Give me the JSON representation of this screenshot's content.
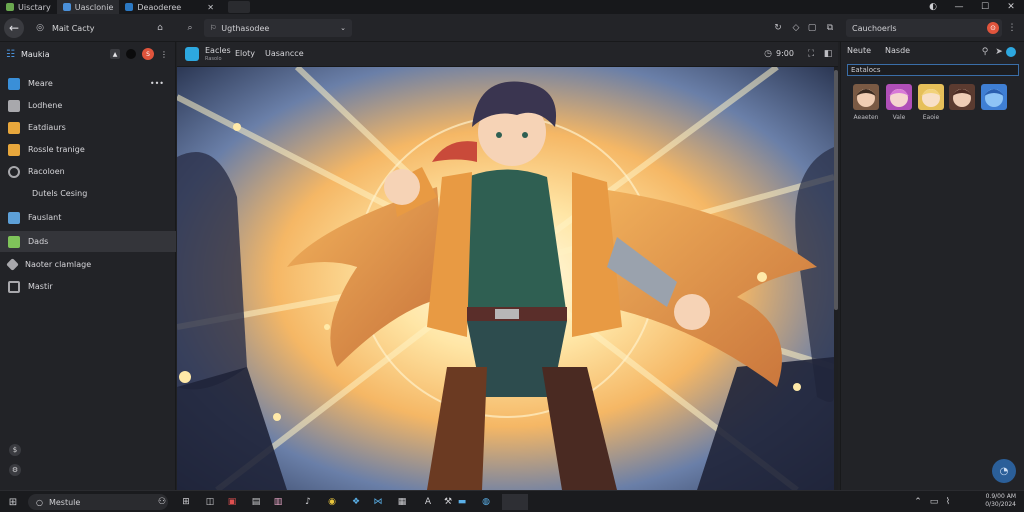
{
  "tabs": [
    {
      "label": "Uisctary",
      "active": false,
      "color": "#6aa84f"
    },
    {
      "label": "Uasclonie",
      "active": true,
      "color": "#4a90d9"
    },
    {
      "label": "Deaoderee",
      "active": false,
      "color": "#2b78c2"
    }
  ],
  "tab_close": "✕",
  "window_controls": {
    "minimize": "—",
    "maximize": "☐",
    "close": "✕"
  },
  "toolbar": {
    "back_icon": "arrow-left-icon",
    "profile_label": "Mait Cacty",
    "address": "Ugthasodee",
    "search_value": "Cauchoerls"
  },
  "sidebar": {
    "title": "Maukia",
    "items": [
      {
        "label": "Meare",
        "color": "#3a8fd8"
      },
      {
        "label": "Lodhene",
        "color": "#a8a8ac"
      },
      {
        "label": "Eatdiaurs",
        "color": "#e8a73c"
      },
      {
        "label": "Rossle tranige",
        "color": "#e8a73c"
      },
      {
        "label": "Racoloen",
        "color": "#a8a8ac"
      },
      {
        "label": "Dutels Cesing",
        "color": null
      },
      {
        "label": "Fauslant",
        "color": "#5da0d8"
      },
      {
        "label": "Dads",
        "color": "#7fc45a"
      },
      {
        "label": "Naoter clamlage",
        "color": "#a8a8ac"
      },
      {
        "label": "Mastir",
        "color": "#a8a8ac"
      }
    ]
  },
  "main": {
    "header_title": "Eacles",
    "header_subtitle": "Rasolo",
    "header_tab": "Eloty",
    "header_link": "Uasancce",
    "time": "9:00"
  },
  "right_panel": {
    "tab1": "Neute",
    "tab2": "Nasde",
    "filter": "Eatalocs",
    "thumbs": [
      {
        "label": "Aeaeten",
        "color": "#7a5a44"
      },
      {
        "label": "Vale",
        "color": "#b04fb8"
      },
      {
        "label": "Eaoie",
        "color": "#e6c05a"
      },
      {
        "label": "",
        "color": "#5b3b30"
      },
      {
        "label": "",
        "color": "#3f7fd4"
      }
    ]
  },
  "taskbar": {
    "search": "Mestule",
    "tray_line1": "0.9/00 AM",
    "tray_line2": "0/30/2024"
  }
}
